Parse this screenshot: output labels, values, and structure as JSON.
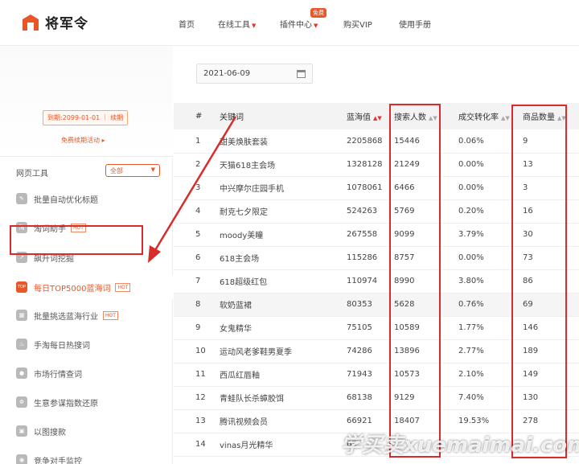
{
  "app": {
    "logo_text": "将军令"
  },
  "nav": {
    "items": [
      "首页",
      "在线工具",
      "插件中心",
      "购买VIP",
      "使用手册"
    ],
    "free_badge": "免费"
  },
  "sidebar": {
    "expire_text": "到期:2099-01-01 ｜ 续期",
    "renew_link": "免费续期活动 ▸",
    "tools_label": "网页工具",
    "filter_value": "全部",
    "hot_label": "HOT",
    "top_icon_text": "TOP",
    "items": [
      {
        "label": "批量自动优化标题",
        "hot": false
      },
      {
        "label": "淘词助手",
        "hot": true
      },
      {
        "label": "飙升词挖掘",
        "hot": false
      },
      {
        "label": "每日TOP5000蓝海词",
        "hot": true
      },
      {
        "label": "批量挑选蓝海行业",
        "hot": true
      },
      {
        "label": "手淘每日热搜词",
        "hot": false
      },
      {
        "label": "市场行情查词",
        "hot": false
      },
      {
        "label": "生意参谋指数还原",
        "hot": false
      },
      {
        "label": "以图搜款",
        "hot": false
      },
      {
        "label": "竞争对手监控",
        "hot": false
      }
    ]
  },
  "main": {
    "date_value": "2021-06-09",
    "columns": [
      "#",
      "关键词",
      "蓝海值",
      "搜索人数",
      "成交转化率",
      "商品数量"
    ],
    "rows": [
      [
        "1",
        "甜美焕肤套装",
        "2205868",
        "15446",
        "0.06%",
        "9"
      ],
      [
        "2",
        "天猫618主会场",
        "1328128",
        "21249",
        "0.00%",
        "13"
      ],
      [
        "3",
        "中兴摩尔庄园手机",
        "1078061",
        "6466",
        "0.00%",
        "3"
      ],
      [
        "4",
        "耐克七夕限定",
        "524263",
        "5769",
        "0.20%",
        "16"
      ],
      [
        "5",
        "moody美瞳",
        "267558",
        "9099",
        "3.79%",
        "30"
      ],
      [
        "6",
        "618主会场",
        "115286",
        "8757",
        "0.00%",
        "73"
      ],
      [
        "7",
        "618超级红包",
        "110974",
        "8990",
        "3.80%",
        "86"
      ],
      [
        "8",
        "软奶蓝裙",
        "80353",
        "5628",
        "0.76%",
        "69"
      ],
      [
        "9",
        "女鬼精华",
        "75105",
        "10589",
        "1.77%",
        "146"
      ],
      [
        "10",
        "运动风老爹鞋男夏季",
        "74286",
        "13896",
        "2.77%",
        "189"
      ],
      [
        "11",
        "西瓜红唇釉",
        "71943",
        "10573",
        "2.10%",
        "149"
      ],
      [
        "12",
        "青蛙队长杀蟑胶饵",
        "68138",
        "9129",
        "7.40%",
        "130"
      ],
      [
        "13",
        "腾讯视频会员",
        "66921",
        "18407",
        "19.53%",
        "278"
      ],
      [
        "14",
        "vinas月光精华",
        "65",
        "",
        "",
        ""
      ]
    ]
  },
  "watermark": "学买卖xuemaimai.com",
  "colors": {
    "accent": "#e8572a",
    "highlight_box": "#d92b2b"
  }
}
